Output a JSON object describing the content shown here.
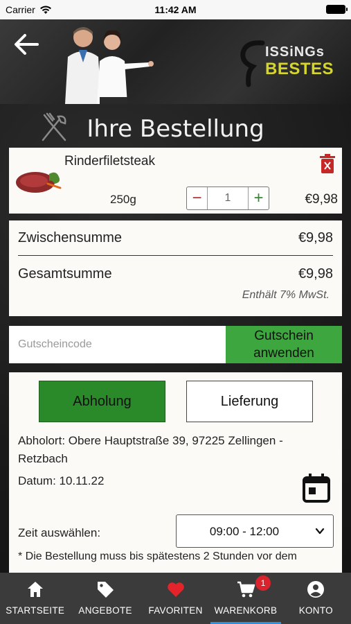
{
  "status_bar": {
    "carrier": "Carrier",
    "time": "11:42 AM"
  },
  "header": {
    "brand_line1": "ISSiNGs",
    "brand_line2": "BESTES"
  },
  "page": {
    "title": "Ihre Bestellung"
  },
  "cart_item": {
    "name": "Rinderfiletsteak",
    "weight": "250g",
    "quantity": "1",
    "price": "€9,98",
    "decrement": "−",
    "increment": "+"
  },
  "totals": {
    "subtotal_label": "Zwischensumme",
    "subtotal_value": "€9,98",
    "total_label": "Gesamtsumme",
    "total_value": "€9,98",
    "vat_note": "Enthält 7% MwSt."
  },
  "coupon": {
    "placeholder": "Gutscheincode",
    "button_line1": "Gutschein",
    "button_line2": "anwenden"
  },
  "delivery": {
    "pickup_label": "Abholung",
    "delivery_label": "Lieferung",
    "selected": "Abholung",
    "address": "Abholort: Obere Hauptstraße 39, 97225 Zellingen - Retzbach",
    "date": "Datum: 10.11.22",
    "time_label": "Zeit auswählen:",
    "time_value": "09:00 - 12:00",
    "note": "* Die Bestellung muss bis spätestens 2 Stunden vor dem"
  },
  "tabbar": {
    "items": [
      {
        "label": "STARTSEITE",
        "icon": "home-icon"
      },
      {
        "label": "ANGEBOTE",
        "icon": "tag-icon"
      },
      {
        "label": "FAVORITEN",
        "icon": "heart-icon"
      },
      {
        "label": "WARENKORB",
        "icon": "cart-icon",
        "badge": "1",
        "active": true
      },
      {
        "label": "KONTO",
        "icon": "account-icon"
      }
    ]
  },
  "colors": {
    "accent_green": "#3ea63e",
    "pickup_green": "#2a8a2a",
    "danger_red": "#c62828",
    "badge_red": "#d9232d",
    "tabbar_bg": "#3b3b3b",
    "active_tab_indicator": "#2f8fd8"
  }
}
